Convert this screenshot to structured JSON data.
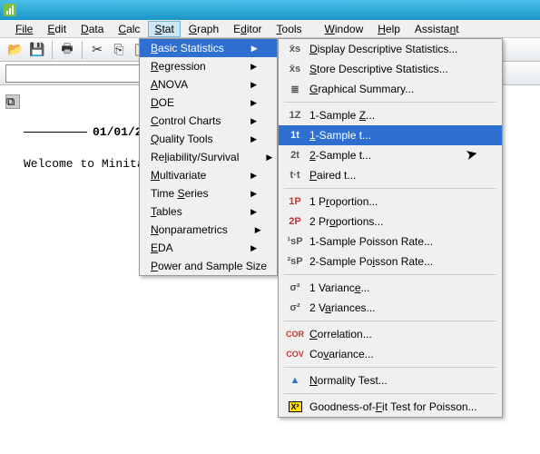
{
  "menu": {
    "file": "File",
    "edit": "Edit",
    "data": "Data",
    "calc": "Calc",
    "stat": "Stat",
    "graph": "Graph",
    "editor": "Editor",
    "tools": "Tools",
    "window": "Window",
    "help": "Help",
    "assistant": "Assistant"
  },
  "stat_menu": {
    "basic_statistics": "Basic Statistics",
    "regression": "Regression",
    "anova": "ANOVA",
    "doe": "DOE",
    "control_charts": "Control Charts",
    "quality_tools": "Quality Tools",
    "reliability": "Reliability/Survival",
    "multivariate": "Multivariate",
    "time_series": "Time Series",
    "tables": "Tables",
    "nonparametrics": "Nonparametrics",
    "eda": "EDA",
    "power": "Power and Sample Size"
  },
  "sub_menu": {
    "display_desc": "Display Descriptive Statistics...",
    "store_desc": "Store Descriptive Statistics...",
    "graphical_summary": "Graphical Summary...",
    "one_sample_z": "1-Sample Z...",
    "one_sample_t": "1-Sample t...",
    "two_sample_t": "2-Sample t...",
    "paired_t": "Paired t...",
    "one_proportion": "1 Proportion...",
    "two_proportions": "2 Proportions...",
    "one_poisson": "1-Sample Poisson Rate...",
    "two_poisson": "2-Sample Poisson Rate...",
    "one_variance": "1 Variance...",
    "two_variances": "2 Variances...",
    "correlation": "Correlation...",
    "covariance": "Covariance...",
    "normality": "Normality Test...",
    "gof_poisson": "Goodness-of-Fit Test for Poisson..."
  },
  "icons": {
    "display_desc": "x̄s",
    "store_desc": "x̄s",
    "graphical_summary": "≣",
    "one_sample_z": "1Z",
    "one_sample_t": "1t",
    "two_sample_t": "2t",
    "paired_t": "t·t",
    "one_proportion": "1P",
    "two_proportions": "2P",
    "one_poisson": "¹sP",
    "two_poisson": "²sP",
    "one_variance": "σ²",
    "two_variances": "σ²",
    "correlation": "COR",
    "covariance": "COV",
    "normality": "▲",
    "gof_poisson": "X²"
  },
  "session": {
    "date": "01/01/2",
    "welcome": "Welcome to Minitab,"
  }
}
